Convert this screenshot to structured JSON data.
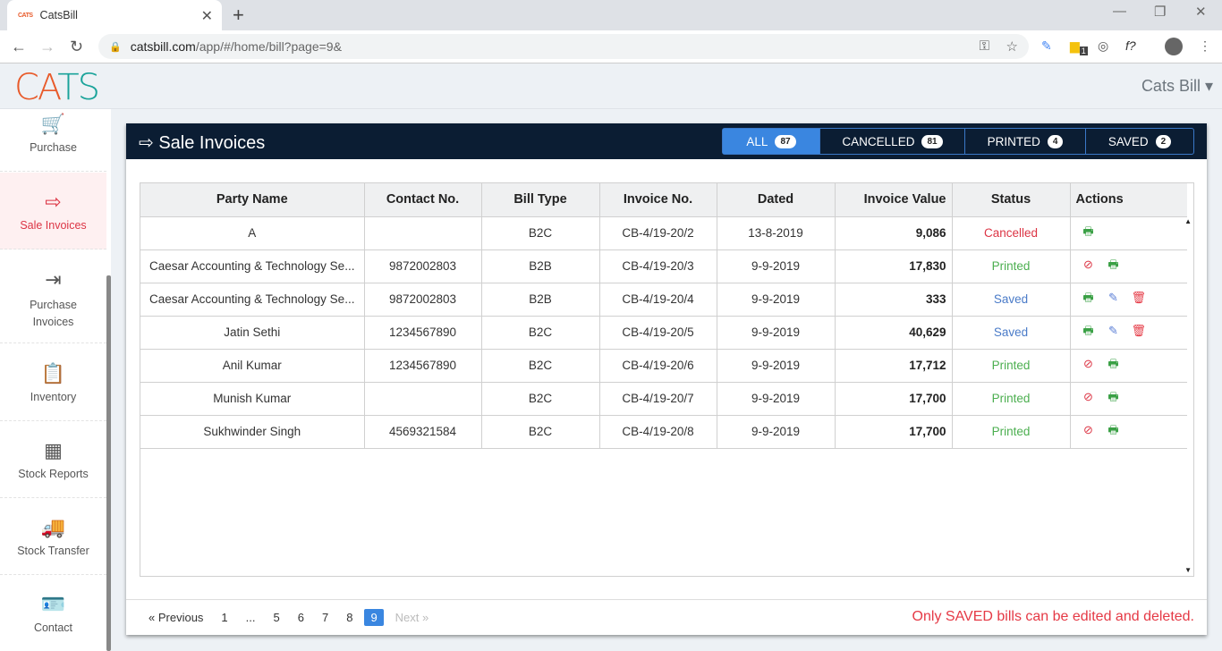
{
  "browser": {
    "tab_title": "CatsBill",
    "favicon_text": "CATS",
    "url_host": "catsbill.com",
    "url_path": "/app/#/home/bill?page=9&",
    "ext_badge": "1"
  },
  "app": {
    "logo_left": "CA",
    "logo_right": "TS",
    "user": "Cats Bill"
  },
  "sidebar": {
    "items": [
      {
        "label": "Purchase",
        "icon": "cart-icon"
      },
      {
        "label": "Sale Invoices",
        "icon": "sign-out-icon",
        "active": true
      },
      {
        "label": "Purchase Invoices",
        "icon": "sign-in-icon"
      },
      {
        "label": "Inventory",
        "icon": "clipboard-icon"
      },
      {
        "label": "Stock Reports",
        "icon": "calculator-icon"
      },
      {
        "label": "Stock Transfer",
        "icon": "truck-icon"
      },
      {
        "label": "Contact",
        "icon": "contact-card-icon"
      }
    ]
  },
  "panel": {
    "title": "Sale Invoices",
    "filters": [
      {
        "label": "ALL",
        "count": "87",
        "active": true
      },
      {
        "label": "CANCELLED",
        "count": "81"
      },
      {
        "label": "PRINTED",
        "count": "4"
      },
      {
        "label": "SAVED",
        "count": "2"
      }
    ]
  },
  "table": {
    "headers": [
      "Party Name",
      "Contact No.",
      "Bill Type",
      "Invoice No.",
      "Dated",
      "Invoice Value",
      "Status",
      "Actions"
    ],
    "rows": [
      {
        "party": "A",
        "contact": "",
        "type": "B2C",
        "invoice": "CB-4/19-20/2",
        "date": "13-8-2019",
        "value": "9,086",
        "status": "Cancelled",
        "actions": [
          "print"
        ]
      },
      {
        "party": "Caesar Accounting & Technology Se...",
        "contact": "9872002803",
        "type": "B2B",
        "invoice": "CB-4/19-20/3",
        "date": "9-9-2019",
        "value": "17,830",
        "status": "Printed",
        "actions": [
          "cancel",
          "print"
        ]
      },
      {
        "party": "Caesar Accounting & Technology Se...",
        "contact": "9872002803",
        "type": "B2B",
        "invoice": "CB-4/19-20/4",
        "date": "9-9-2019",
        "value": "333",
        "status": "Saved",
        "actions": [
          "print",
          "edit",
          "delete"
        ]
      },
      {
        "party": "Jatin Sethi",
        "contact": "1234567890",
        "type": "B2C",
        "invoice": "CB-4/19-20/5",
        "date": "9-9-2019",
        "value": "40,629",
        "status": "Saved",
        "actions": [
          "print",
          "edit",
          "delete"
        ]
      },
      {
        "party": "Anil Kumar",
        "contact": "1234567890",
        "type": "B2C",
        "invoice": "CB-4/19-20/6",
        "date": "9-9-2019",
        "value": "17,712",
        "status": "Printed",
        "actions": [
          "cancel",
          "print"
        ]
      },
      {
        "party": "Munish Kumar",
        "contact": "",
        "type": "B2C",
        "invoice": "CB-4/19-20/7",
        "date": "9-9-2019",
        "value": "17,700",
        "status": "Printed",
        "actions": [
          "cancel",
          "print"
        ]
      },
      {
        "party": "Sukhwinder Singh",
        "contact": "4569321584",
        "type": "B2C",
        "invoice": "CB-4/19-20/8",
        "date": "9-9-2019",
        "value": "17,700",
        "status": "Printed",
        "actions": [
          "cancel",
          "print"
        ]
      }
    ]
  },
  "pagination": {
    "prev": "« Previous",
    "pages": [
      "1",
      "...",
      "5",
      "6",
      "7",
      "8",
      "9"
    ],
    "current": "9",
    "next": "Next »"
  },
  "note": "Only SAVED bills can be edited and deleted."
}
